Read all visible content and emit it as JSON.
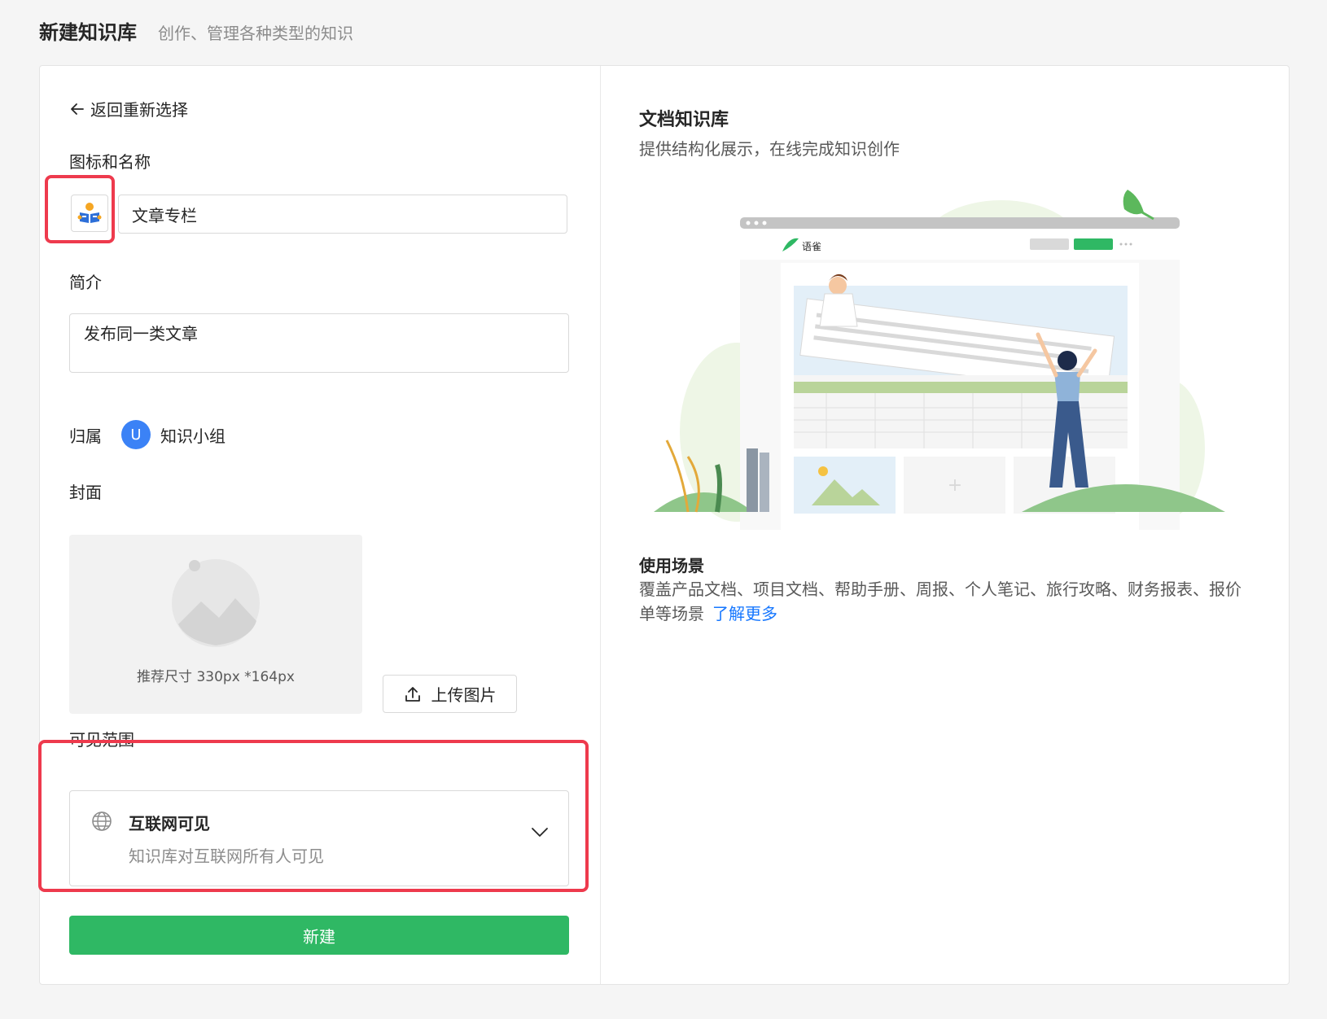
{
  "header": {
    "title": "新建知识库",
    "subtitle": "创作、管理各种类型的知识"
  },
  "form": {
    "back_label": "返回重新选择",
    "icon_name_label": "图标和名称",
    "name_value": "文章专栏",
    "intro_label": "简介",
    "intro_value": "发布同一类文章",
    "owner_label": "归属",
    "owner_avatar_letter": "U",
    "owner_name": "知识小组",
    "cover_label": "封面",
    "cover_hint": "推荐尺寸 330px *164px",
    "upload_label": "上传图片",
    "visibility_label": "可见范围",
    "visibility_title": "互联网可见",
    "visibility_desc": "知识库对互联网所有人可见",
    "create_label": "新建"
  },
  "preview": {
    "title": "文档知识库",
    "desc": "提供结构化展示，在线完成知识创作",
    "illustration_brand": "语雀",
    "usage_title": "使用场景",
    "usage_text": "覆盖产品文档、项目文档、帮助手册、周报、个人笔记、旅行攻略、财务报表、报价单等场景",
    "usage_link": "了解更多"
  },
  "colors": {
    "accent_green": "#2fb864",
    "highlight_red": "#ee3a4d",
    "link_blue": "#1677ff",
    "avatar_blue": "#3b82f6"
  },
  "icons": [
    "arrow-left-icon",
    "book-reader-icon",
    "image-placeholder-icon",
    "upload-icon",
    "globe-icon",
    "chevron-down-icon"
  ]
}
